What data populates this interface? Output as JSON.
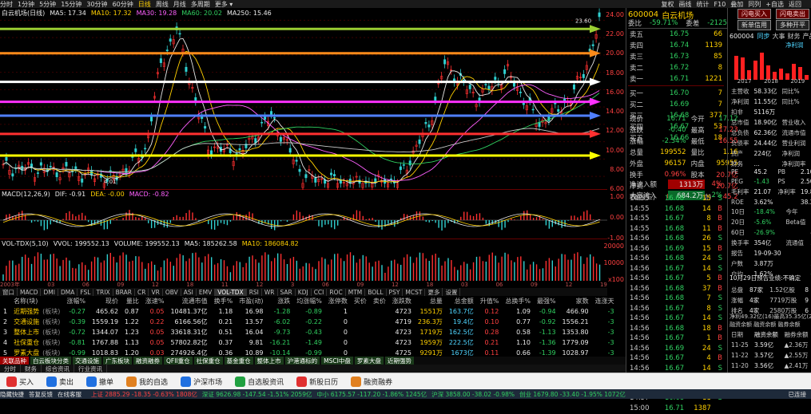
{
  "topbar": {
    "items": [
      "分时",
      "1分钟",
      "5分钟",
      "15分钟",
      "30分钟",
      "60分钟",
      "日线",
      "周线",
      "月线",
      "多周期",
      "更多 ▾"
    ],
    "right": [
      "复权",
      "画线",
      "统计",
      "F10",
      "叠加",
      "同列",
      "+自选",
      "返回"
    ]
  },
  "chart": {
    "title": "白云机场(日线)",
    "ma": [
      {
        "label": "MA5: 17.34",
        "color": "#e8e8e8"
      },
      {
        "label": "MA10: 17.32",
        "color": "#ffd000"
      },
      {
        "label": "MA30: 19.28",
        "color": "#ff60ff"
      },
      {
        "label": "MA60: 20.02",
        "color": "#30d060"
      },
      {
        "label": "MA250: 15.46",
        "color": "#e8e8e8"
      }
    ],
    "yaxis": [
      "24.00",
      "22.00",
      "20.00",
      "18.00",
      "16.00",
      "14.00",
      "12.00",
      "10.00",
      "8.00",
      "6.00"
    ],
    "high_label": "23.60",
    "low_label": "4.01",
    "hlines": [
      {
        "color": "#9acd32"
      },
      {
        "color": "#ff8c1a"
      },
      {
        "color": "#ffffff"
      },
      {
        "color": "#ff30ff"
      },
      {
        "color": "#4f7fff"
      },
      {
        "color": "#ff3030"
      },
      {
        "color": "#ffff00"
      }
    ]
  },
  "macd": {
    "info": [
      "MACD(12,26,9)",
      "DIF: -0.91",
      "DEA: -0.00",
      "MACD: -0.82"
    ],
    "yaxis": [
      "1.00",
      "0.00",
      "-1.00"
    ]
  },
  "vol": {
    "info": [
      "VOL-TDX(5,10)",
      "VVOL: 199552.13",
      "VOLUME: 199552.13",
      "MA5: 185262.58",
      "MA10: 186084.82"
    ],
    "yaxis": [
      "20000",
      "10000",
      "x100"
    ]
  },
  "date_axis": [
    "2003年",
    "03",
    "06",
    "09",
    "12",
    "18",
    "11",
    "12",
    "3",
    "06",
    "09",
    "12",
    "18",
    "03",
    "06",
    "09",
    "12",
    "19"
  ],
  "indicator_tabs": [
    "窗口",
    "MACD",
    "DMI",
    "DMA",
    "FSL",
    "TRIX",
    "BRAR",
    "CR",
    "VR",
    "OBV",
    "ASI",
    "EMV",
    "VOL-TDX",
    "RSI",
    "WR",
    "SAR",
    "KDJ",
    "CCI",
    "ROC",
    "MTM",
    "BOLL",
    "PSY",
    "MCST",
    "更多",
    "设置"
  ],
  "table": {
    "headers": [
      "名称(块)",
      "涨幅%",
      "现价",
      "量比",
      "涨速%",
      "流通市值",
      "换手%",
      "市盈(动)",
      "涨跌",
      "均涨幅%",
      "涨停数",
      "买价",
      "卖价",
      "涨跌数",
      "总量",
      "总金额",
      "升值%",
      "总换手%",
      "最强%",
      "家数",
      "连涨天"
    ],
    "rows": [
      {
        "idx": "1",
        "name": "近期强势",
        "tag": "(板块)",
        "c": [
          "-0.27",
          "465.62",
          "0.87",
          "0.05",
          "10481.37亿",
          "1.18",
          "16.98",
          "-1.28",
          "-0.89",
          "1",
          "",
          "",
          "4723",
          "1551万",
          "163.7亿",
          "0.12",
          "1.09",
          "-0.94",
          "466.90",
          "-3"
        ]
      },
      {
        "idx": "2",
        "name": "交通设施",
        "tag": "(板块)",
        "c": [
          "-0.39",
          "1559.19",
          "1.22",
          "0.22",
          "6166.56亿",
          "0.21",
          "13.57",
          "-6.02",
          "-0.22",
          "0",
          "",
          "",
          "4719",
          "236.3万",
          "19.4亿",
          "0.10",
          "0.77",
          "-0.92",
          "1556.21",
          "-3"
        ]
      },
      {
        "idx": "3",
        "name": "整体上市",
        "tag": "(板块)",
        "c": [
          "-0.72",
          "1344.07",
          "1.23",
          "0.05",
          "33618.31亿",
          "0.51",
          "16.04",
          "-9.73",
          "-0.43",
          "0",
          "",
          "",
          "4723",
          "1719万",
          "162.5亿",
          "0.28",
          "0.58",
          "-1.13",
          "1353.80",
          "-3"
        ]
      },
      {
        "idx": "4",
        "name": "社保重仓",
        "tag": "(板块)",
        "c": [
          "-0.81",
          "1767.88",
          "1.13",
          "0.05",
          "57802.82亿",
          "0.37",
          "9.81",
          "-16.21",
          "-1.49",
          "0",
          "",
          "",
          "4723",
          "1959万",
          "222.5亿",
          "0.21",
          "1.10",
          "-1.36",
          "1779.09",
          "-3"
        ]
      },
      {
        "idx": "5",
        "name": "罗素大盘",
        "tag": "(板块)",
        "c": [
          "-0.99",
          "1018.83",
          "1.20",
          "0.03",
          "274926.4亿",
          "0.36",
          "10.89",
          "-10.14",
          "-0.99",
          "0",
          "",
          "",
          "4725",
          "9291万",
          "1673亿",
          "0.11",
          "0.66",
          "-1.39",
          "1028.97",
          "-3"
        ]
      }
    ]
  },
  "sector_tabs": [
    "关联品种",
    "白云板块分类",
    "交通设施",
    "广东板块",
    "融资融券",
    "QFII重仓",
    "社保重仓",
    "基金重仓",
    "整体上市",
    "沪港通标的",
    "MSCI中盘",
    "罗素大盘",
    "近期强势"
  ],
  "bottom_tabs": [
    "分时",
    "财务",
    "综合资讯",
    "行业资讯"
  ],
  "right_panel": {
    "buttons": [
      "闪电买入",
      "闪电卖出",
      "新单信用",
      "多种开平"
    ],
    "code": "600004",
    "name": "白云机场",
    "weibi_label": "委比",
    "weibi_val": "-59.71%",
    "weicha_label": "委差",
    "weicha_val": "-2125",
    "asks": [
      {
        "lvl": "卖五",
        "p": "16.75",
        "v": "66"
      },
      {
        "lvl": "卖四",
        "p": "16.74",
        "v": "1139"
      },
      {
        "lvl": "卖三",
        "p": "16.73",
        "v": "85"
      },
      {
        "lvl": "卖二",
        "p": "16.72",
        "v": "8"
      },
      {
        "lvl": "卖一",
        "p": "16.71",
        "v": "1221"
      }
    ],
    "bids": [
      {
        "lvl": "买一",
        "p": "16.70",
        "v": "7"
      },
      {
        "lvl": "买二",
        "p": "16.69",
        "v": "7"
      },
      {
        "lvl": "买三",
        "p": "16.68",
        "v": "377"
      },
      {
        "lvl": "买四",
        "p": "16.67",
        "v": "53"
      },
      {
        "lvl": "买五",
        "p": "16.66",
        "v": "18"
      }
    ],
    "quote": [
      [
        "现价",
        "16.71",
        "今开",
        "17.12"
      ],
      [
        "涨跌",
        "-0.40",
        "最高",
        "17.23"
      ],
      [
        "涨幅",
        "-2.34%",
        "最低",
        "16.55"
      ],
      [
        "总量",
        "199552",
        "量比",
        "1.16"
      ],
      [
        "外盘",
        "96157",
        "内盘",
        "95955"
      ],
      [
        "换手",
        "0.96%",
        "股本",
        "20.7亿"
      ],
      [
        "净资",
        "7.66",
        "流通",
        "20.7亿"
      ],
      [
        "收益(三)",
        "0.277",
        "PE(动)",
        "45.2"
      ]
    ],
    "flow": [
      [
        "净流入额",
        "1313万",
        "4%"
      ],
      [
        "大宗流入",
        "684.2万",
        "2%"
      ]
    ],
    "ticks": [
      [
        "14:55",
        "16.68",
        "15",
        "S"
      ],
      [
        "14:55",
        "16.68",
        "14",
        "B"
      ],
      [
        "14:55",
        "16.67",
        "8",
        "B"
      ],
      [
        "14:55",
        "16.68",
        "11",
        "B"
      ],
      [
        "14:56",
        "16.68",
        "26",
        "S"
      ],
      [
        "14:56",
        "16.69",
        "15",
        "B"
      ],
      [
        "14:56",
        "16.68",
        "24",
        "S"
      ],
      [
        "14:56",
        "16.67",
        "14",
        "S"
      ],
      [
        "14:56",
        "16.67",
        "5",
        "B"
      ],
      [
        "14:56",
        "16.68",
        "37",
        "B"
      ],
      [
        "14:56",
        "16.68",
        "7",
        "S"
      ],
      [
        "14:56",
        "16.67",
        "8",
        "S"
      ],
      [
        "14:56",
        "16.67",
        "14",
        "S"
      ],
      [
        "14:56",
        "16.68",
        "18",
        "B"
      ],
      [
        "14:56",
        "16.67",
        "1",
        "B"
      ],
      [
        "14:56",
        "16.69",
        "24",
        "S"
      ],
      [
        "14:56",
        "16.67",
        "4",
        "B"
      ],
      [
        "14:56",
        "16.67",
        "14",
        "S"
      ],
      [
        "14:56",
        "16.68",
        "6",
        "B"
      ],
      [
        "14:56",
        "16.68",
        "32",
        "B"
      ],
      [
        "14:57",
        "16.68",
        "11",
        "S"
      ],
      [
        "15:00",
        "16.71",
        "1387",
        ""
      ]
    ],
    "tabs": [
      "盘口",
      "关联",
      "笔",
      "价",
      "细",
      "势",
      "指",
      "联",
      "值",
      "主",
      "筹"
    ],
    "f10_code": "600004",
    "f10_tabs": [
      "同步",
      "大事",
      "财务",
      "产品",
      "盈利预测"
    ],
    "bars_title": "净利润",
    "years": [
      "2017",
      "2018",
      "2019"
    ],
    "fin": [
      [
        "主营收",
        "58.33亿",
        "同比%",
        "73.62"
      ],
      [
        "净利润",
        "11.55亿",
        "同比%",
        "-37.64"
      ],
      [
        "扣非",
        "5116万",
        "",
        "889万"
      ],
      [
        "总市值",
        "18.90亿",
        "营业收入",
        "12.71亿"
      ],
      [
        "总负债",
        "62.36亿",
        "流通市值",
        "3605万"
      ],
      [
        "负债率",
        "24.44亿",
        "营业利润",
        "0.15亿"
      ],
      [
        "资产",
        "224亿",
        "净利润",
        "1.59亿"
      ],
      [
        "财务",
        "...",
        "净利润率",
        "1.59亿"
      ]
    ],
    "stats": [
      [
        "PE",
        "45.2",
        "PB",
        "2.10"
      ],
      [
        "PEG",
        "-1.43",
        "PS",
        "2.50"
      ],
      [
        "毛利率",
        "21.07",
        "净利率",
        "19.80"
      ],
      [
        "ROE",
        "3.62%",
        "",
        "38.25"
      ]
    ],
    "more": [
      [
        "10日",
        "-18.4%",
        "今年",
        "73.2%"
      ],
      [
        "20日",
        "-5.6%",
        "Beta值",
        "1.33"
      ],
      [
        "60日",
        "-26.9%",
        "",
        "42.27"
      ],
      [
        "换手率",
        "354亿",
        "流通值",
        "354亿"
      ],
      [
        "报告",
        "19-09-30",
        "",
        "19-06-30"
      ],
      [
        "户数",
        "3.87万",
        "",
        "3.81万"
      ],
      [
        "户均",
        "1.62%",
        "",
        "-14.50%"
      ]
    ],
    "notice": "10月29日预告业绩:不确定",
    "capital": [
      [
        "总盘",
        "87家",
        "1.52亿股",
        "8"
      ],
      [
        "涨幅",
        "4家",
        "7719万股",
        "9"
      ],
      [
        "排名",
        "4家",
        "2580万股",
        "6"
      ]
    ],
    "dividend": [
      "净利49.32亿(16)最高35.35亿(21)",
      "融资余额 融资余额 融券余额"
    ],
    "margin": [
      [
        "日期",
        "融资余额",
        "融券余额"
      ],
      [
        "11-25",
        "3.59亿",
        "▲2.36万"
      ],
      [
        "11-22",
        "3.57亿",
        "▲2.55万"
      ],
      [
        "11-20",
        "3.56亿",
        "▲2.41万"
      ],
      [
        "11-19",
        "3.58亿",
        "▲2.54万"
      ],
      [
        "11-18",
        "3.50亿",
        "▲2.43万"
      ]
    ]
  },
  "toolbar": [
    "买入",
    "卖出",
    "撤单",
    "我的自选",
    "沪深市场",
    "自选股资讯",
    "新股日历",
    "融资融券"
  ],
  "statusbar": {
    "left": [
      "隐藏快捷",
      "答复反馈",
      "在线客服"
    ],
    "sh": "上证 2885.29 -18.35 -0.63% 1808亿",
    "sz": "深证 9626.98 -147.54 -1.51% 2059亿",
    "zx": "中小 6175.57 -117.20 -1.86% 1245亿",
    "hs": "沪深 3858.00 -38.02 -0.98%",
    "cy": "创业 1679.80 -33.40 -1.95% 1072亿",
    "right": "已连接"
  }
}
